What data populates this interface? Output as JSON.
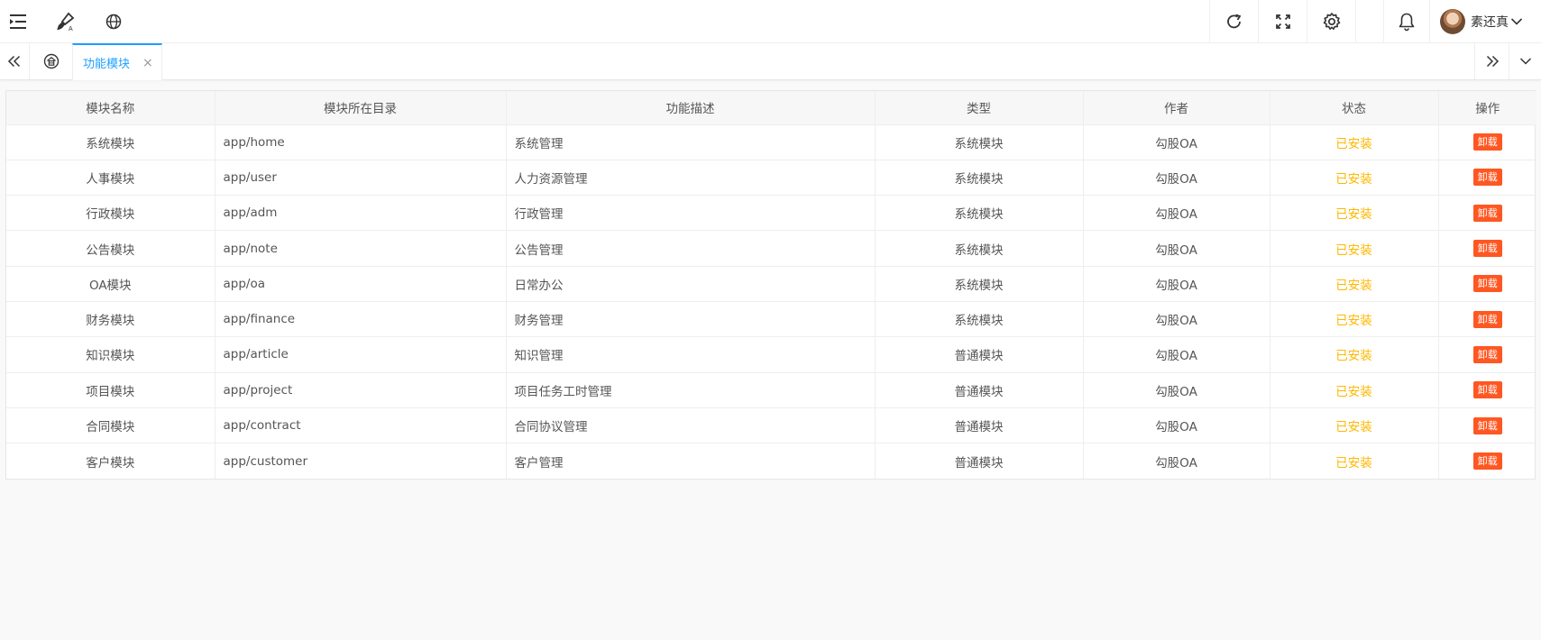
{
  "header": {
    "icons": [
      "menu-fold-icon",
      "theme-brush-icon",
      "globe-icon",
      "refresh-icon",
      "fullscreen-icon",
      "settings-gear-icon",
      "bell-icon"
    ],
    "user_name": "素还真",
    "user_dropdown_icon": "chevron-down-icon"
  },
  "tabs": {
    "active_label": "功能模块",
    "close_symbol": "×",
    "home_icon": "home-lock-icon",
    "accent_color": "#1e9fff"
  },
  "table": {
    "columns": [
      "模块名称",
      "模块所在目录",
      "功能描述",
      "类型",
      "作者",
      "状态",
      "操作"
    ],
    "rows": [
      {
        "name": "系统模块",
        "dir": "app/home",
        "desc": "系统管理",
        "type": "系统模块",
        "author": "勾股OA",
        "status": "已安装",
        "action": "卸载"
      },
      {
        "name": "人事模块",
        "dir": "app/user",
        "desc": "人力资源管理",
        "type": "系统模块",
        "author": "勾股OA",
        "status": "已安装",
        "action": "卸载"
      },
      {
        "name": "行政模块",
        "dir": "app/adm",
        "desc": "行政管理",
        "type": "系统模块",
        "author": "勾股OA",
        "status": "已安装",
        "action": "卸载"
      },
      {
        "name": "公告模块",
        "dir": "app/note",
        "desc": "公告管理",
        "type": "系统模块",
        "author": "勾股OA",
        "status": "已安装",
        "action": "卸载"
      },
      {
        "name": "OA模块",
        "dir": "app/oa",
        "desc": "日常办公",
        "type": "系统模块",
        "author": "勾股OA",
        "status": "已安装",
        "action": "卸载"
      },
      {
        "name": "财务模块",
        "dir": "app/finance",
        "desc": "财务管理",
        "type": "系统模块",
        "author": "勾股OA",
        "status": "已安装",
        "action": "卸载"
      },
      {
        "name": "知识模块",
        "dir": "app/article",
        "desc": "知识管理",
        "type": "普通模块",
        "author": "勾股OA",
        "status": "已安装",
        "action": "卸载"
      },
      {
        "name": "项目模块",
        "dir": "app/project",
        "desc": "项目任务工时管理",
        "type": "普通模块",
        "author": "勾股OA",
        "status": "已安装",
        "action": "卸载"
      },
      {
        "name": "合同模块",
        "dir": "app/contract",
        "desc": "合同协议管理",
        "type": "普通模块",
        "author": "勾股OA",
        "status": "已安装",
        "action": "卸载"
      },
      {
        "name": "客户模块",
        "dir": "app/customer",
        "desc": "客户管理",
        "type": "普通模块",
        "author": "勾股OA",
        "status": "已安装",
        "action": "卸载"
      }
    ]
  },
  "colors": {
    "status_installed": "#ffb800",
    "uninstall_button": "#ff5722"
  }
}
